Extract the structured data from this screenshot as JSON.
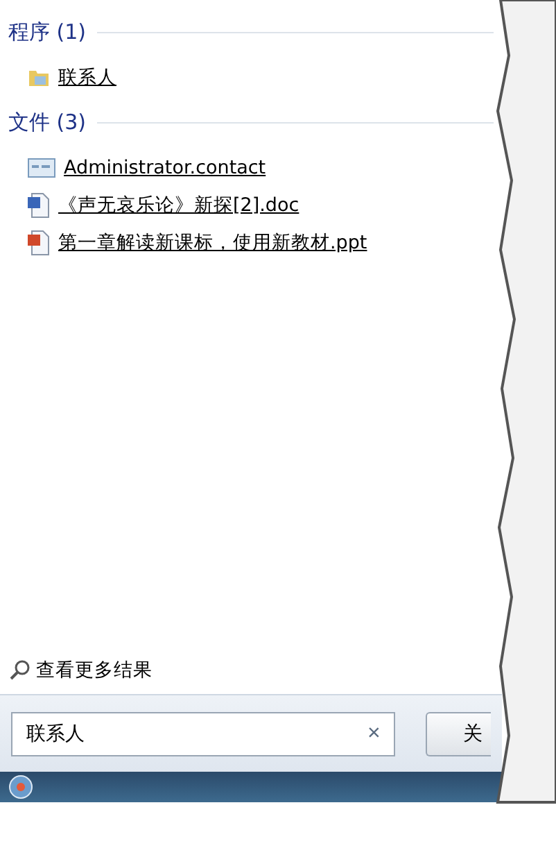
{
  "groups": [
    {
      "title": "程序 (1)",
      "items": [
        {
          "kind": "folder",
          "label": "联系人"
        }
      ]
    },
    {
      "title": "文件 (3)",
      "items": [
        {
          "kind": "contact",
          "label": "Administrator.contact"
        },
        {
          "kind": "word",
          "label": "《声无哀乐论》新探[2].doc"
        },
        {
          "kind": "ppt",
          "label": "第一章解读新课标，使用新教材.ppt"
        }
      ]
    }
  ],
  "more_results": "查看更多结果",
  "search": {
    "value": "联系人",
    "clear": "×"
  },
  "shutdown_button": "关"
}
